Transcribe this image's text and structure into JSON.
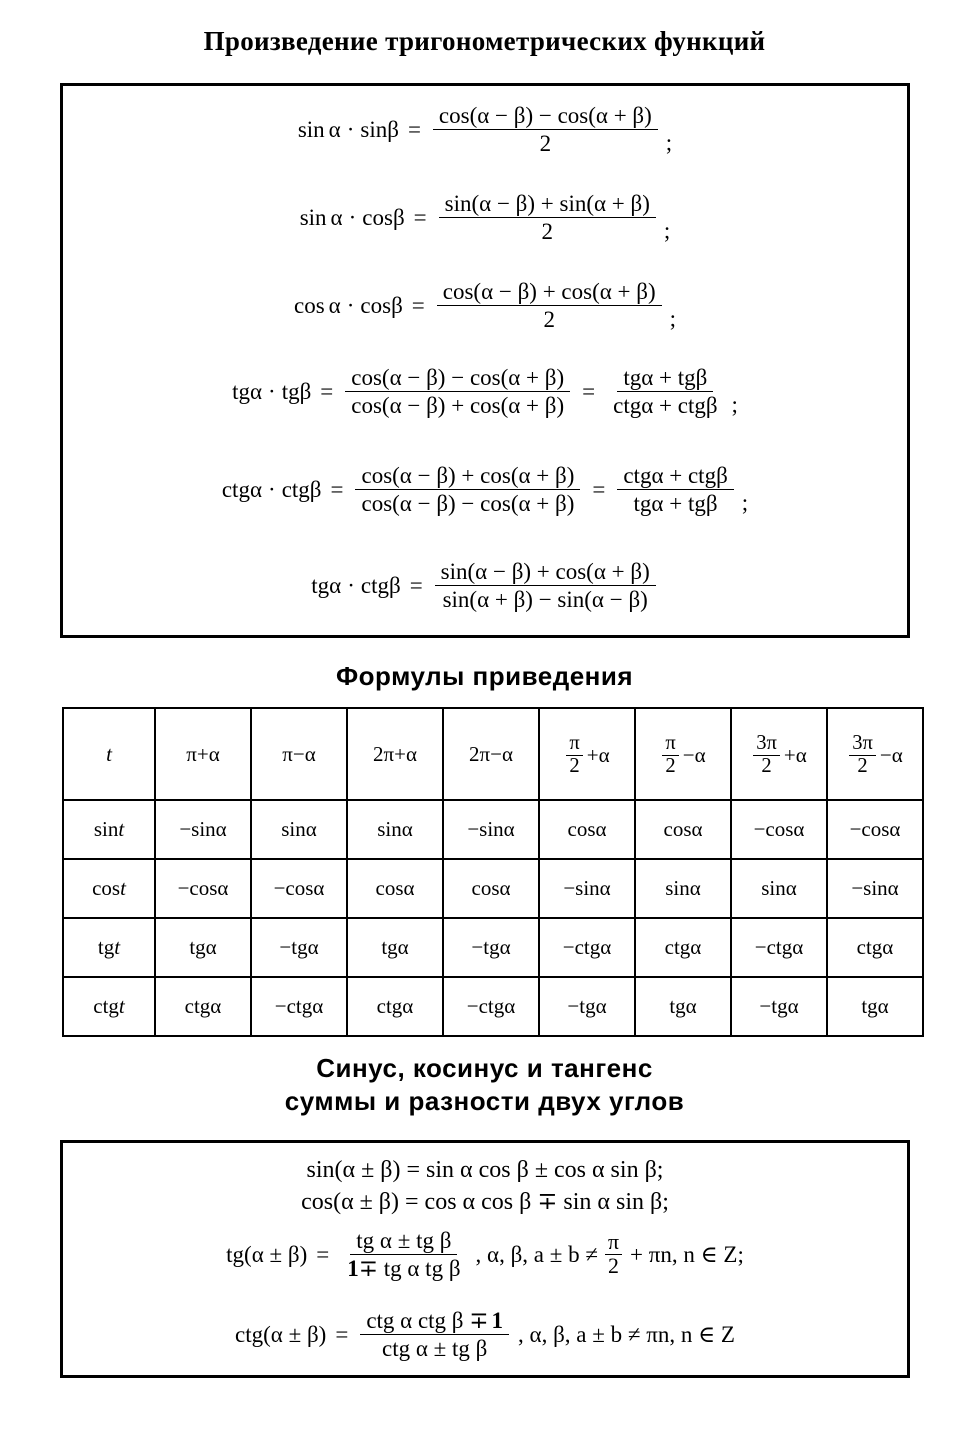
{
  "headings": {
    "products": "Произведение тригонометрических функций",
    "reduction": "Формулы приведения",
    "sumdiff_line1": "Синус, косинус и тангенс",
    "sumdiff_line2": "суммы и разности двух углов"
  },
  "symbols": {
    "alpha": "α",
    "beta": "β",
    "pi": "π",
    "cdot": "·",
    "plus": "+",
    "minus": "−",
    "pm": "±",
    "mp": "∓",
    "eq": "=",
    "neq": "≠",
    "in": "∈",
    "semicolon": ";",
    "comma": ",",
    "two": "2",
    "one": "1",
    "three_pi": "3π",
    "two_pi": "2π",
    "t": "t",
    "n": "n",
    "Z": "Z",
    "a": "a",
    "b": "b",
    "sin": "sin",
    "cos": "cos",
    "tg": "tg",
    "ctg": "ctg"
  },
  "products_box": {
    "lines": [
      {
        "id": "sin-sin",
        "lhs": [
          "sin",
          "α",
          "·",
          "sin",
          "β"
        ],
        "numerator": "cos(α − β) − cos(α + β)",
        "denominator": "2",
        "terminator": ";"
      },
      {
        "id": "sin-cos",
        "lhs": [
          "sin",
          "α",
          "·",
          "cos",
          "β"
        ],
        "numerator": "sin(α − β) + sin(α + β)",
        "denominator": "2",
        "terminator": ";"
      },
      {
        "id": "cos-cos",
        "lhs": [
          "cos",
          "α",
          "·",
          "cos",
          "β"
        ],
        "numerator": "cos(α − β) + cos(α + β)",
        "denominator": "2",
        "terminator": ";"
      },
      {
        "id": "tg-tg",
        "lhs": [
          "tg",
          "α",
          "·",
          "tg",
          "β"
        ],
        "numerator": "cos(α − β) − cos(α + β)",
        "denominator": "cos(α − β) + cos(α + β)",
        "second_numerator": "tgα + tgβ",
        "second_denominator": "ctgα + ctgβ",
        "terminator": ";"
      },
      {
        "id": "ctg-ctg",
        "lhs": [
          "ctg",
          "α",
          "·",
          "ctg",
          "β"
        ],
        "numerator": "cos(α − β) + cos(α + β)",
        "denominator": "cos(α − β) − cos(α + β)",
        "second_numerator": "ctgα + ctgβ",
        "second_denominator": "tgα + tgβ",
        "terminator": ";"
      },
      {
        "id": "tg-ctg",
        "lhs": [
          "tg",
          "α",
          "·",
          "ctg",
          "β"
        ],
        "numerator": "sin(α − β) + cos(α + β)",
        "denominator": "sin(α + β) − sin(α − β)",
        "terminator": ""
      }
    ]
  },
  "reduction_table": {
    "header": [
      "t",
      "π+α",
      "π−α",
      "2π+α",
      "2π−α",
      "π/2+α",
      "π/2−α",
      "3π/2+α",
      "3π/2−α"
    ],
    "rows": [
      {
        "label": "sin t",
        "values": [
          "−sinα",
          "sinα",
          "sinα",
          "−sinα",
          "cosα",
          "cosα",
          "−cosα",
          "−cosα"
        ]
      },
      {
        "label": "cos t",
        "values": [
          "−cosα",
          "−cosα",
          "cosα",
          "cosα",
          "−sinα",
          "sinα",
          "sinα",
          "−sinα"
        ]
      },
      {
        "label": "tg t",
        "values": [
          "tgα",
          "−tgα",
          "tgα",
          "−tgα",
          "−ctgα",
          "ctgα",
          "−ctgα",
          "ctgα"
        ]
      },
      {
        "label": "ctg t",
        "values": [
          "ctgα",
          "−ctgα",
          "ctgα",
          "−ctgα",
          "−tgα",
          "tgα",
          "−tgα",
          "tgα"
        ]
      }
    ]
  },
  "sumdiff_box": {
    "line_sin": "sin(α ± β) = sin α cos β ± cos α sin β;",
    "line_cos": "cos(α ± β) = cos α cos β ∓ sin α sin β;",
    "line_tg": {
      "lhs": "tg(α ± β)",
      "numerator": "tg α ± tg β",
      "denominator_pre": "1",
      "denominator_rest": "∓ tg α tg β",
      "condition_pre": ", α, β, a ± b ≠",
      "condition_frac_num": "π",
      "condition_frac_den": "2",
      "condition_post": "+ πn, n ∈ Z;"
    },
    "line_ctg": {
      "lhs": "ctg(α ± β)",
      "numerator_pre": "ctg α ctg β ∓",
      "numerator_bold": "1",
      "denominator": "ctg α ± tg β",
      "condition": ", α, β, a ± b ≠ πn, n ∈ Z"
    }
  }
}
